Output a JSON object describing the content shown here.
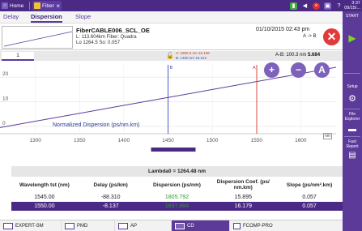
{
  "topbar": {
    "home_label": "Home",
    "tab_label": "Fiber",
    "time": "3:37",
    "date": "09/15/..."
  },
  "subtabs": [
    "Delay",
    "Dispersion",
    "Slope"
  ],
  "file": {
    "name": "FiberCABLE006_SCL_OE",
    "line1": "L: 113.604km  Fiber: Quadra",
    "line2": "Lo 1264.5  So: 0.057",
    "datetime": "01/10/2015 02:43 pm",
    "direction": "A -> B"
  },
  "chart_toolbar": {
    "page_tab": "1",
    "marker_a": "A: 1550.3 nm 16.106",
    "marker_b": "B: 1450 nm 15.312",
    "ab_label": "A-B: 100.3 nm",
    "ab_value": "5.684"
  },
  "chart_data": {
    "type": "line",
    "title": "Normalized Dispersion (ps/nm.km)",
    "xlabel": "",
    "unit_box": "nm",
    "xlim": [
      1260,
      1640
    ],
    "ylim": [
      -3,
      25
    ],
    "x_ticks": [
      1300,
      1350,
      1400,
      1450,
      1500,
      1550,
      1600
    ],
    "y_ticks": [
      0,
      10,
      20
    ],
    "series": [
      {
        "name": "Dispersion",
        "x": [
          1260,
          1640
        ],
        "y": [
          -0.5,
          24
        ],
        "color": "#5b3a99"
      }
    ],
    "marker_a_x": 1550.3,
    "marker_b_x": 1450,
    "marker_a_label": "A",
    "marker_b_label": "B",
    "grid": true
  },
  "buttons": {
    "zoom_in": "+",
    "zoom_out": "−",
    "auto": "A"
  },
  "lambda_label": "Lambda0 = 1264.48 nm",
  "table": {
    "headers": [
      "Wavelength tst (nm)",
      "Delay (ps/km)",
      "Dispersion (ps/nm)",
      "Dispersion Coef. (ps/ nm.km)",
      "Slope (ps/nm².km)"
    ],
    "rows": [
      [
        "1545.00",
        "-88.310",
        "1805.792",
        "15.895",
        "0.057"
      ],
      [
        "1550.00",
        "-8.137",
        "1837.984",
        "16.179",
        "0.057"
      ]
    ]
  },
  "side_panel": {
    "start": "START",
    "setup": "Setup",
    "file_explorer": "File Explorer",
    "fast_report": "Fast Report"
  },
  "bottom_tabs": [
    "EXPERT-SM",
    "PMD",
    "AP",
    "CD",
    "FCOMP-PRO"
  ],
  "colors": {
    "brand": "#5b3a99",
    "topbar": "#4b2a86",
    "marker_a": "#d9342b",
    "marker_b": "#3b4cb8",
    "close": "#e03a3a",
    "start": "#7ed321"
  }
}
